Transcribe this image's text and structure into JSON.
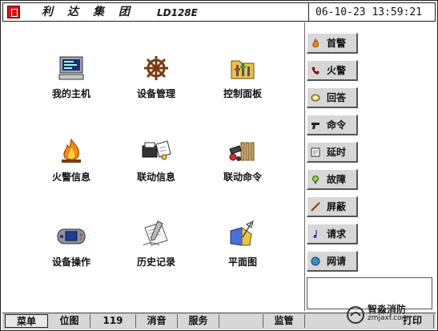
{
  "header": {
    "brand": "利达集团",
    "model": "LD128E",
    "datetime": "06-10-23 13:59:21"
  },
  "desktop": {
    "items": [
      {
        "label": "我的主机",
        "icon": "computer-icon"
      },
      {
        "label": "设备管理",
        "icon": "ship-wheel-icon"
      },
      {
        "label": "控制面板",
        "icon": "control-folder-icon"
      },
      {
        "label": "火警信息",
        "icon": "fire-icon"
      },
      {
        "label": "联动信息",
        "icon": "document-printer-icon"
      },
      {
        "label": "联动命令",
        "icon": "command-tools-icon"
      },
      {
        "label": "设备操作",
        "icon": "handheld-device-icon"
      },
      {
        "label": "历史记录",
        "icon": "history-note-icon"
      },
      {
        "label": "平面图",
        "icon": "floor-plan-icon"
      }
    ]
  },
  "sidebar": {
    "buttons": [
      {
        "label": "首警",
        "icon": "first-alarm-icon"
      },
      {
        "label": "火警",
        "icon": "phone-icon"
      },
      {
        "label": "回答",
        "icon": "answer-icon"
      },
      {
        "label": "命令",
        "icon": "pistol-icon"
      },
      {
        "label": "延时",
        "icon": "delay-icon"
      },
      {
        "label": "故障",
        "icon": "bulb-icon"
      },
      {
        "label": "屏蔽",
        "icon": "shield-stick-icon"
      },
      {
        "label": "请求",
        "icon": "note-icon"
      },
      {
        "label": "网请",
        "icon": "network-icon"
      }
    ]
  },
  "bottom_tabs": [
    "菜单",
    "位图",
    "119",
    "消音",
    "服务",
    "",
    "监管",
    "打印"
  ],
  "watermark": {
    "cn": "智淼消防",
    "url": "zmjaxf.com"
  }
}
